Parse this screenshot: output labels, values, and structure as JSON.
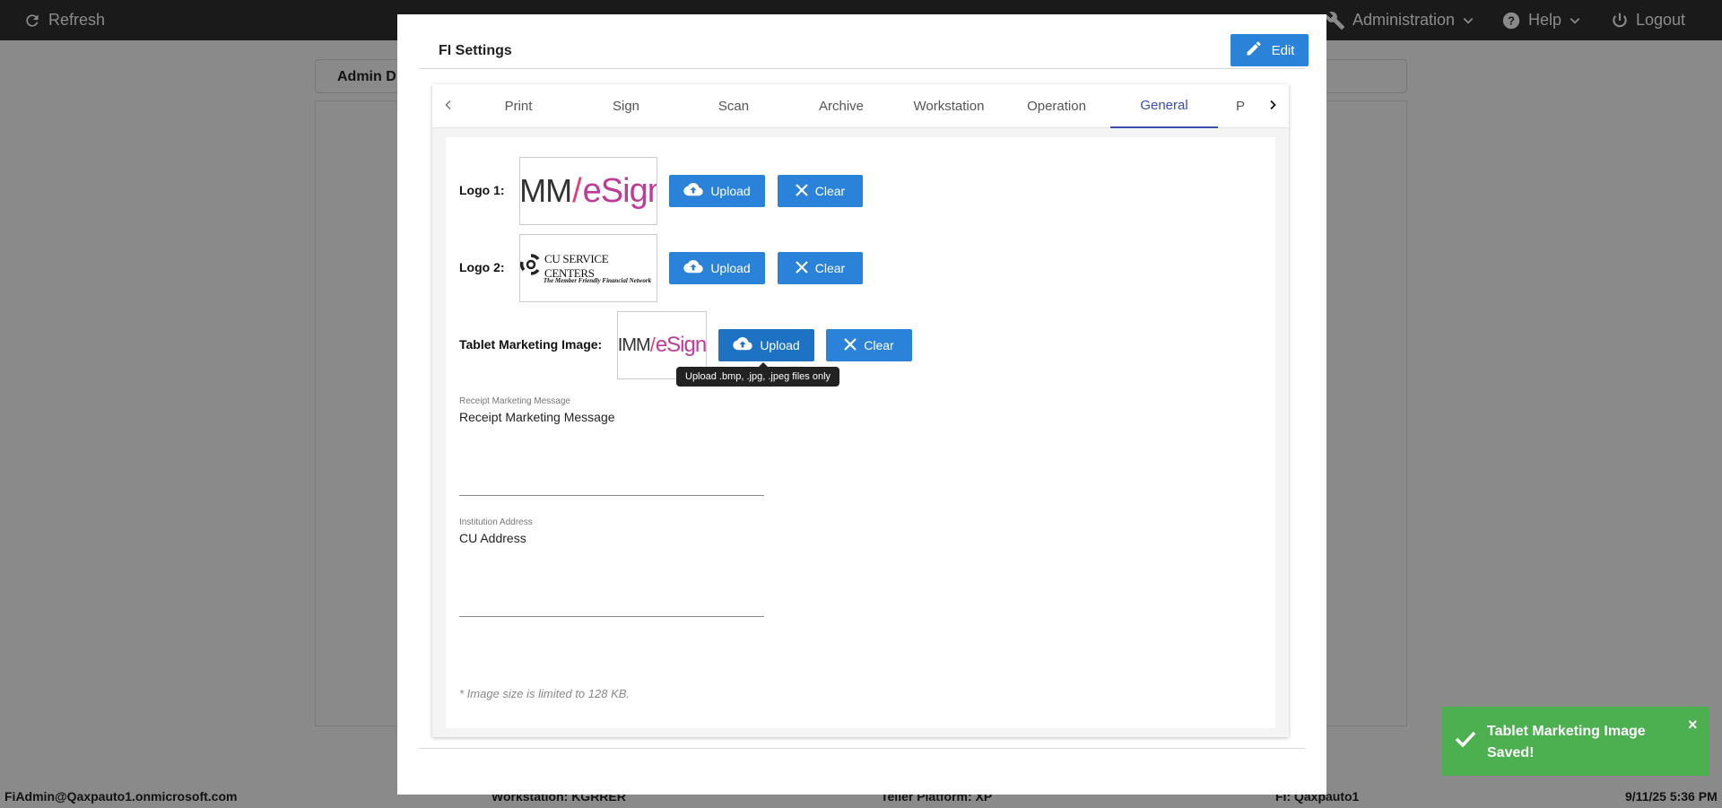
{
  "topbar": {
    "refresh_label": "Refresh",
    "administration_label": "Administration",
    "help_label": "Help",
    "logout_label": "Logout"
  },
  "background": {
    "admin_header_label": "Admin D"
  },
  "modal": {
    "title": "FI Settings",
    "edit_label": "Edit",
    "tabs": [
      {
        "label": "Print"
      },
      {
        "label": "Sign"
      },
      {
        "label": "Scan"
      },
      {
        "label": "Archive"
      },
      {
        "label": "Workstation"
      },
      {
        "label": "Operation"
      },
      {
        "label": "General"
      },
      {
        "label": "P"
      }
    ],
    "active_tab": "General",
    "general": {
      "logo1_label": "Logo 1:",
      "logo2_label": "Logo 2:",
      "tablet_label": "Tablet Marketing Image:",
      "logo1_image_text": {
        "imm": "IMM",
        "esign": "eSign"
      },
      "logo2_image_text": {
        "main": "CU SERVICE CENTERS",
        "tagline": "The Member Friendly Financial Network"
      },
      "tablet_image_text": {
        "imm": "IMM",
        "esign": "eSign"
      },
      "upload_label": "Upload",
      "clear_label": "Clear",
      "tooltip": "Upload .bmp, .jpg, .jpeg files only",
      "receipt_field_label": "Receipt Marketing Message",
      "receipt_field_value": "Receipt Marketing Message",
      "address_field_label": "Institution Address",
      "address_field_value": "CU Address",
      "note": "* Image size is limited to 128 KB."
    }
  },
  "footer": {
    "user": "FiAdmin@Qaxpauto1.onmicrosoft.com",
    "workstation": "Workstation: KGRRER",
    "teller_platform": "Teller Platform: XP",
    "fi": "FI: Qaxpauto1",
    "datetime": "9/11/25 5:36 PM"
  },
  "toast": {
    "message": "Tablet Marketing Image Saved!",
    "close": "×"
  },
  "colors": {
    "primary_button": "#2a83d8",
    "active_tab": "#3a4db0",
    "toast_success": "#4caf50",
    "topbar": "#303030"
  }
}
